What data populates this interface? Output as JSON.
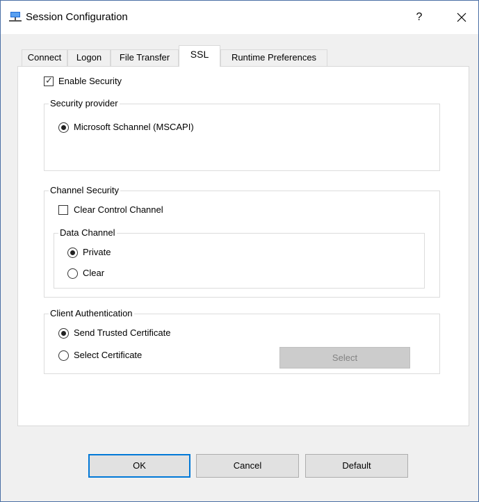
{
  "window": {
    "title": "Session Configuration",
    "help_glyph": "?",
    "close_glyph": "✕"
  },
  "tabs": [
    {
      "label": "Connect"
    },
    {
      "label": "Logon"
    },
    {
      "label": "File Transfer"
    },
    {
      "label": "SSL",
      "active": true
    },
    {
      "label": "Runtime Preferences"
    }
  ],
  "ssl": {
    "enable_security": {
      "label": "Enable Security",
      "checked": true
    },
    "security_provider": {
      "title": "Security provider",
      "options": [
        {
          "label": "Microsoft Schannel (MSCAPI)",
          "selected": true
        }
      ]
    },
    "channel_security": {
      "title": "Channel Security",
      "clear_control_channel": {
        "label": "Clear Control Channel",
        "checked": false
      },
      "data_channel": {
        "title": "Data Channel",
        "options": [
          {
            "label": "Private",
            "selected": true
          },
          {
            "label": "Clear",
            "selected": false
          }
        ]
      }
    },
    "client_authentication": {
      "title": "Client Authentication",
      "options": [
        {
          "label": "Send Trusted Certificate",
          "selected": true
        },
        {
          "label": "Select Certificate",
          "selected": false
        }
      ],
      "select_button": "Select"
    }
  },
  "buttons": {
    "ok": "OK",
    "cancel": "Cancel",
    "default": "Default"
  },
  "colors": {
    "accent": "#0078d7",
    "panel": "#ffffff",
    "window": "#f0f0f0"
  },
  "icons": {
    "app": "ftp-network-icon",
    "help": "help-icon",
    "close": "close-icon"
  }
}
